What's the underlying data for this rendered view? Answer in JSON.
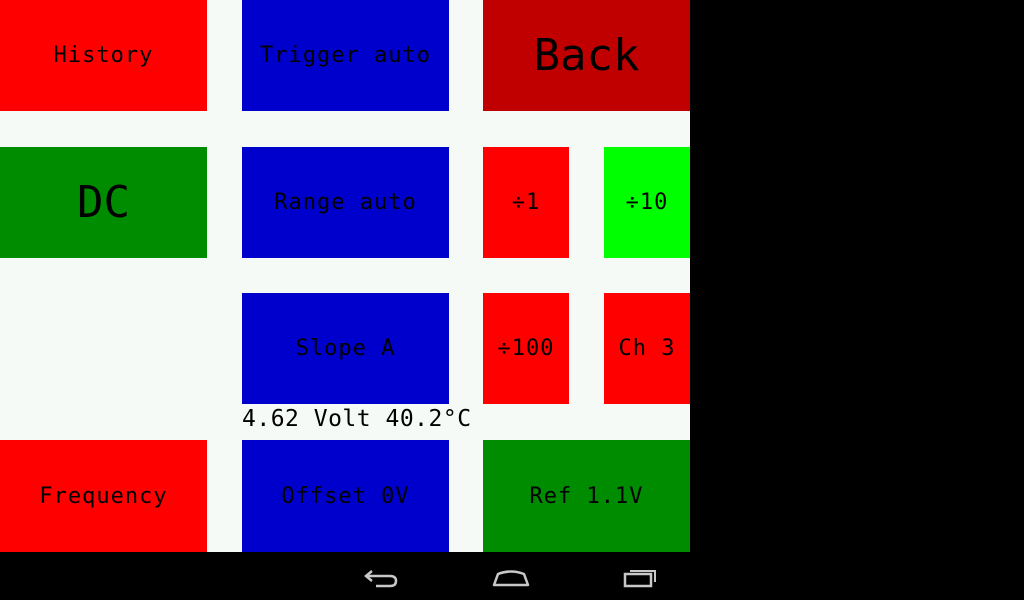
{
  "colors": {
    "red": "#ff0000",
    "dark_red": "#c00000",
    "blue": "#0000cc",
    "green": "#008c00",
    "bright_green": "#00ff00",
    "background": "#f5faf7",
    "system_bar": "#000000"
  },
  "buttons": {
    "history": "History",
    "trigger": "Trigger auto",
    "back": "Back",
    "coupling": "DC",
    "range": "Range auto",
    "div1": "÷1",
    "div10": "÷10",
    "slope": "Slope A",
    "div100": "÷100",
    "channel": "Ch 3",
    "frequency": "Frequency",
    "offset": "Offset 0V",
    "reference": "Ref 1.1V"
  },
  "status": {
    "reading": "4.62 Volt 40.2°C"
  },
  "navbar": {
    "icons": [
      "back-icon",
      "home-icon",
      "recent-apps-icon"
    ]
  }
}
